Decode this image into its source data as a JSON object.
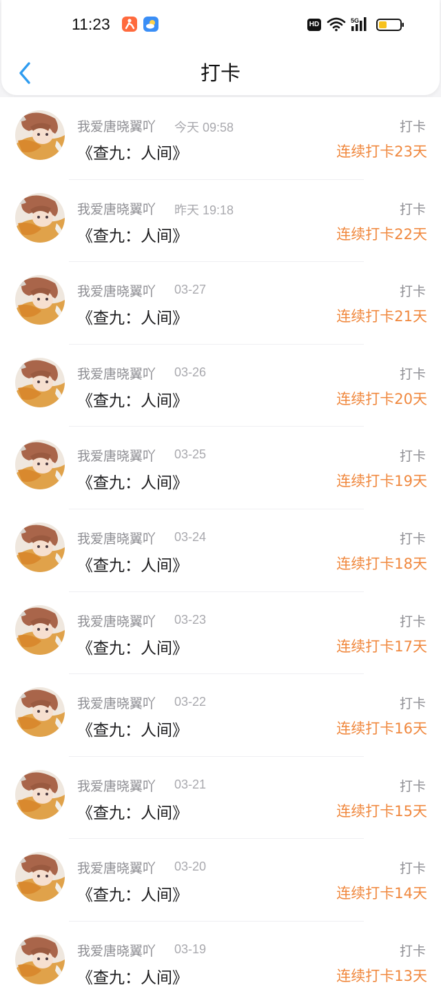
{
  "status_bar": {
    "time": "11:23",
    "hd_badge": "HD",
    "network": "5G",
    "icons": [
      "app-notification-icon",
      "weather-icon",
      "hd-icon",
      "wifi-icon",
      "signal-icon",
      "battery-icon"
    ]
  },
  "header": {
    "title": "打卡",
    "back_icon": "chevron-left-icon",
    "accent_color": "#2f9cf0"
  },
  "colors": {
    "streak": "#f0883e",
    "muted_text": "#8e8e93",
    "title_text": "#1c1c1e"
  },
  "items": [
    {
      "user": "我爱唐晓翼吖",
      "time": "今天 09:58",
      "book": "《查九：人间》",
      "action": "打卡",
      "streak": "连续打卡23天"
    },
    {
      "user": "我爱唐晓翼吖",
      "time": "昨天 19:18",
      "book": "《查九：人间》",
      "action": "打卡",
      "streak": "连续打卡22天"
    },
    {
      "user": "我爱唐晓翼吖",
      "time": "03-27",
      "book": "《查九：人间》",
      "action": "打卡",
      "streak": "连续打卡21天"
    },
    {
      "user": "我爱唐晓翼吖",
      "time": "03-26",
      "book": "《查九：人间》",
      "action": "打卡",
      "streak": "连续打卡20天"
    },
    {
      "user": "我爱唐晓翼吖",
      "time": "03-25",
      "book": "《查九：人间》",
      "action": "打卡",
      "streak": "连续打卡19天"
    },
    {
      "user": "我爱唐晓翼吖",
      "time": "03-24",
      "book": "《查九：人间》",
      "action": "打卡",
      "streak": "连续打卡18天"
    },
    {
      "user": "我爱唐晓翼吖",
      "time": "03-23",
      "book": "《查九：人间》",
      "action": "打卡",
      "streak": "连续打卡17天"
    },
    {
      "user": "我爱唐晓翼吖",
      "time": "03-22",
      "book": "《查九：人间》",
      "action": "打卡",
      "streak": "连续打卡16天"
    },
    {
      "user": "我爱唐晓翼吖",
      "time": "03-21",
      "book": "《查九：人间》",
      "action": "打卡",
      "streak": "连续打卡15天"
    },
    {
      "user": "我爱唐晓翼吖",
      "time": "03-20",
      "book": "《查九：人间》",
      "action": "打卡",
      "streak": "连续打卡14天"
    },
    {
      "user": "我爱唐晓翼吖",
      "time": "03-19",
      "book": "《查九：人间》",
      "action": "打卡",
      "streak": "连续打卡13天"
    }
  ]
}
